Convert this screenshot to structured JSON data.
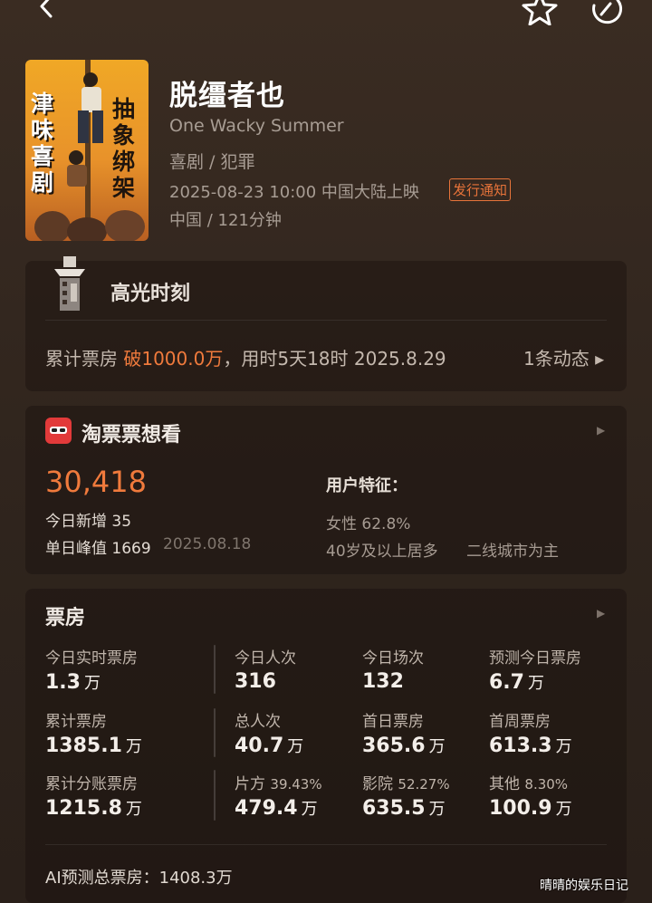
{
  "movie": {
    "title": "脱缰者也",
    "original_title": "One Wacky Summer",
    "genre": "喜剧 / 犯罪",
    "release": "2025-08-23 10:00 中国大陆上映",
    "release_badge": "发行通知",
    "country_duration": "中国 / 121分钟"
  },
  "poster": {
    "left_text": "津味喜剧",
    "right_text": "抽象绑架"
  },
  "highlight": {
    "title": "高光时刻",
    "text_prefix": "累计票房 ",
    "text_emphasis": "破1000.0万",
    "text_suffix": "，用时5天18时 2025.8.29",
    "more": "1条动态 ▸"
  },
  "taopiao": {
    "title": "淘票票想看",
    "count": "30,418",
    "today_new": "今日新增 35",
    "daily_peak": "单日峰值 1669",
    "peak_date": "2025.08.18",
    "features_title": "用户特征：",
    "feature_gender": "女性 62.8%",
    "feature_age": "40岁及以上居多",
    "feature_city": "二线城市为主"
  },
  "boxoffice": {
    "title": "票房",
    "unit": "万",
    "rows": [
      [
        {
          "label": "今日实时票房",
          "pct": "",
          "value": "1.3",
          "unit": "万"
        },
        {
          "label": "今日人次",
          "pct": "",
          "value": "316",
          "unit": ""
        },
        {
          "label": "今日场次",
          "pct": "",
          "value": "132",
          "unit": ""
        },
        {
          "label": "预测今日票房",
          "pct": "",
          "value": "6.7",
          "unit": "万"
        }
      ],
      [
        {
          "label": "累计票房",
          "pct": "",
          "value": "1385.1",
          "unit": "万"
        },
        {
          "label": "总人次",
          "pct": "",
          "value": "40.7",
          "unit": "万"
        },
        {
          "label": "首日票房",
          "pct": "",
          "value": "365.6",
          "unit": "万"
        },
        {
          "label": "首周票房",
          "pct": "",
          "value": "613.3",
          "unit": "万"
        }
      ],
      [
        {
          "label": "累计分账票房",
          "pct": "",
          "value": "1215.8",
          "unit": "万"
        },
        {
          "label": "片方",
          "pct": "39.43%",
          "value": "479.4",
          "unit": "万"
        },
        {
          "label": "影院",
          "pct": "52.27%",
          "value": "635.5",
          "unit": "万"
        },
        {
          "label": "其他",
          "pct": "8.30%",
          "value": "100.9",
          "unit": "万"
        }
      ]
    ],
    "ai_forecast": "AI预测总票房：1408.3万"
  },
  "watermark": "晴晴的娱乐日记",
  "icons": [
    "back-icon",
    "star-icon",
    "share-icon",
    "film-highlight-icon",
    "taopiao-logo-icon",
    "chevron-right-icon"
  ],
  "colors": {
    "accent": "#f07a3c",
    "taopiao": "#e23a3a"
  }
}
